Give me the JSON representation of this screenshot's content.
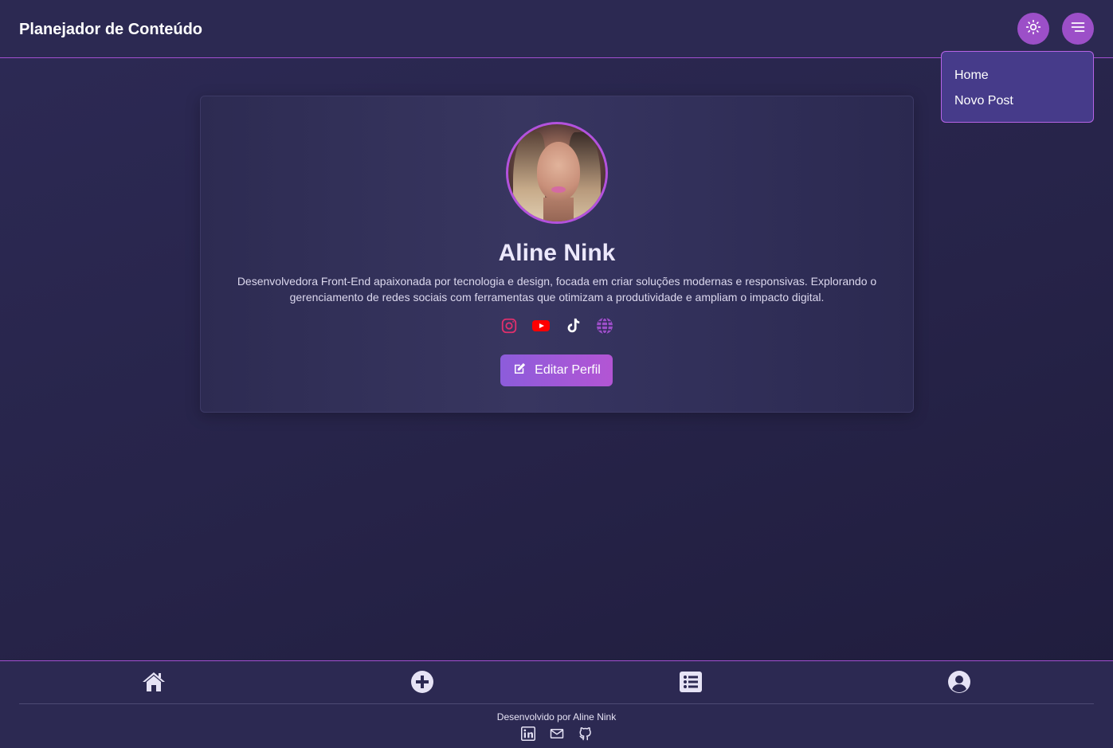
{
  "header": {
    "title": "Planejador de Conteúdo",
    "theme_icon": "sun-icon",
    "menu_icon": "hamburger-menu-icon"
  },
  "dropdown": {
    "items": [
      {
        "label": "Home"
      },
      {
        "label": "Novo Post"
      }
    ]
  },
  "profile": {
    "name": "Aline Nink",
    "bio": "Desenvolvedora Front-End apaixonada por tecnologia e design, focada em criar soluções modernas e responsivas. Explorando o gerenciamento de redes sociais com ferramentas que otimizam a produtividade e ampliam o impacto digital.",
    "socials": [
      {
        "icon": "instagram-icon",
        "color": "#e1306c"
      },
      {
        "icon": "youtube-icon",
        "color": "#ff0000"
      },
      {
        "icon": "tiktok-icon",
        "color": "#ffffff"
      },
      {
        "icon": "globe-icon",
        "color": "#9c4fc8"
      }
    ],
    "edit_label": "Editar Perfil"
  },
  "bottom_nav": {
    "items": [
      {
        "icon": "home-icon"
      },
      {
        "icon": "plus-circle-icon"
      },
      {
        "icon": "list-icon"
      },
      {
        "icon": "user-circle-icon"
      }
    ]
  },
  "footer": {
    "credit": "Desenvolvido por Aline Nink",
    "icons": [
      "linkedin-icon",
      "mail-icon",
      "github-icon"
    ]
  },
  "colors": {
    "accent": "#9c4fc8",
    "background": "#2c2952",
    "dropdown": "#463b8a"
  }
}
